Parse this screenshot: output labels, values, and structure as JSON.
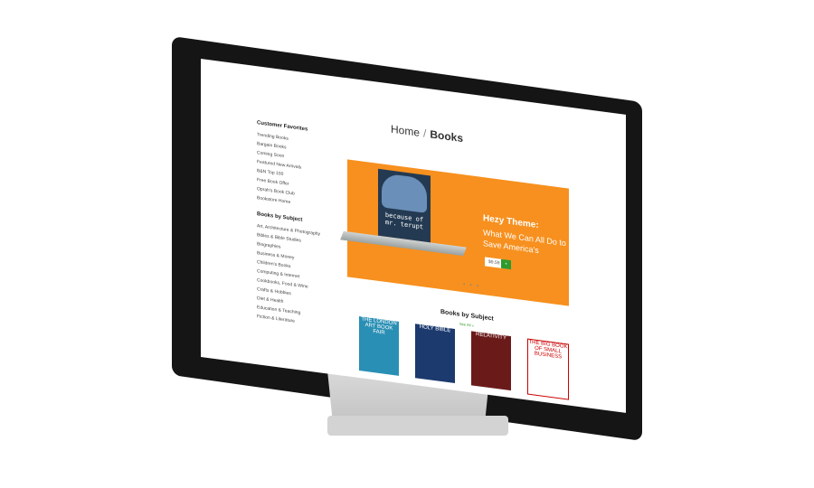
{
  "breadcrumb": {
    "home": "Home",
    "separator": "/",
    "current": "Books"
  },
  "sidebar": {
    "favorites_heading": "Customer Favorites",
    "favorites": [
      "Trending Books",
      "Bargain Books",
      "Coming Soon",
      "Featured New Arrivals",
      "B&N Top 100",
      "Free Book Offer",
      "Oprah's Book Club",
      "Bookstore Home"
    ],
    "subject_heading": "Books by Subject",
    "subjects": [
      "Art, Architecture & Photography",
      "Bibles & Bible Studies",
      "Biographies",
      "Business & Money",
      "Children's Books",
      "Computing & Internet",
      "Cookbooks, Food & Wine",
      "Crafts & Hobbies",
      "Diet & Health",
      "Education & Teaching",
      "Fiction & Literature"
    ]
  },
  "hero": {
    "book_title": "because of mr. terupt",
    "headline": "Hezy Theme:",
    "subheadline": "What We Can All Do to Save America's",
    "price": "$9.59",
    "cart_label": "+",
    "bg_color": "#f7901e"
  },
  "subject_section": {
    "title": "Books by Subject",
    "see_all": "See All »",
    "covers": [
      {
        "title": "THE LONDON ART BOOK FAIR",
        "color": "#2a8fb5"
      },
      {
        "title": "HOLY BIBLE",
        "color": "#1c3a6e"
      },
      {
        "title": "RELATIVITY",
        "color": "#6b1a1a"
      },
      {
        "title": "THE BIG BOOK OF SMALL BUSINESS",
        "color": "#ffffff"
      }
    ]
  }
}
